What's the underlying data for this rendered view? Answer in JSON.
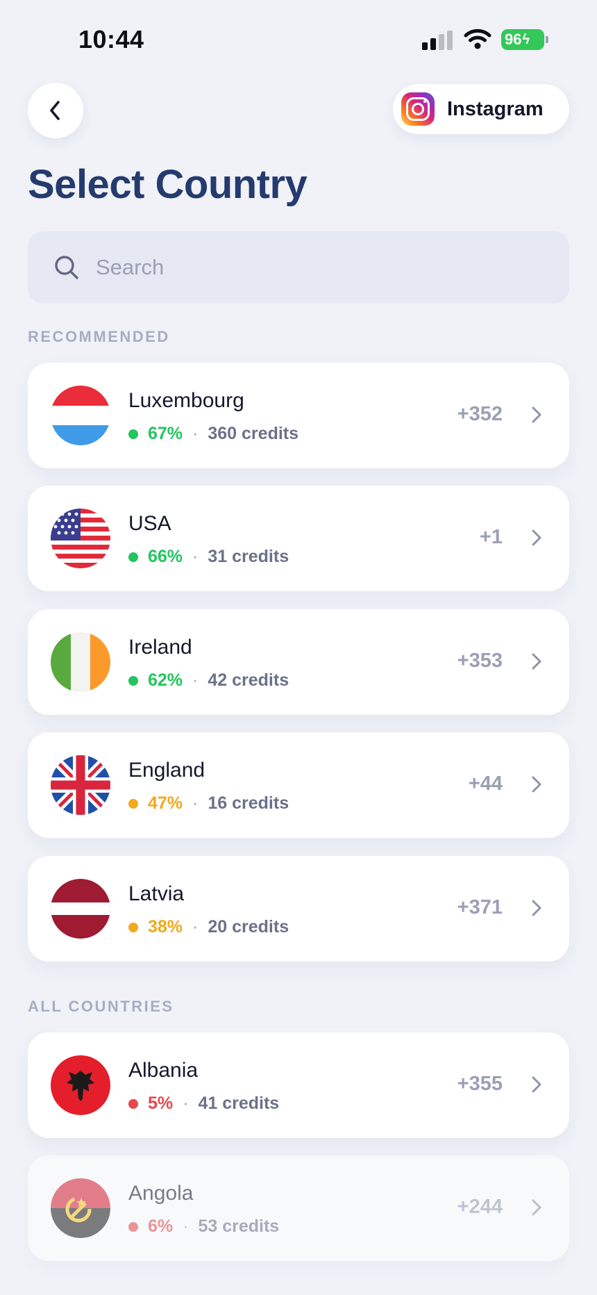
{
  "status_bar": {
    "time": "10:44",
    "battery": "96"
  },
  "header": {
    "platform_label": "Instagram",
    "title": "Select Country"
  },
  "search": {
    "placeholder": "Search"
  },
  "sections": {
    "recommended_label": "RECOMMENDED",
    "all_label": "ALL COUNTRIES"
  },
  "recommended": [
    {
      "name": "Luxembourg",
      "pct": "67%",
      "credits": "360 credits",
      "code": "+352",
      "status_color": "#22c55e"
    },
    {
      "name": "USA",
      "pct": "66%",
      "credits": "31 credits",
      "code": "+1",
      "status_color": "#22c55e"
    },
    {
      "name": "Ireland",
      "pct": "62%",
      "credits": "42 credits",
      "code": "+353",
      "status_color": "#22c55e"
    },
    {
      "name": "England",
      "pct": "47%",
      "credits": "16 credits",
      "code": "+44",
      "status_color": "#f2a91e"
    },
    {
      "name": "Latvia",
      "pct": "38%",
      "credits": "20 credits",
      "code": "+371",
      "status_color": "#f2a91e"
    }
  ],
  "all_countries": [
    {
      "name": "Albania",
      "pct": "5%",
      "credits": "41 credits",
      "code": "+355",
      "status_color": "#e5484d"
    },
    {
      "name": "Angola",
      "pct": "6%",
      "credits": "53 credits",
      "code": "+244",
      "status_color": "#e5484d"
    }
  ],
  "separator": "·",
  "icons": {
    "back": "chevron-left-icon",
    "search": "search-icon",
    "row_action": "chevron-right-icon",
    "platform": "instagram-icon"
  }
}
